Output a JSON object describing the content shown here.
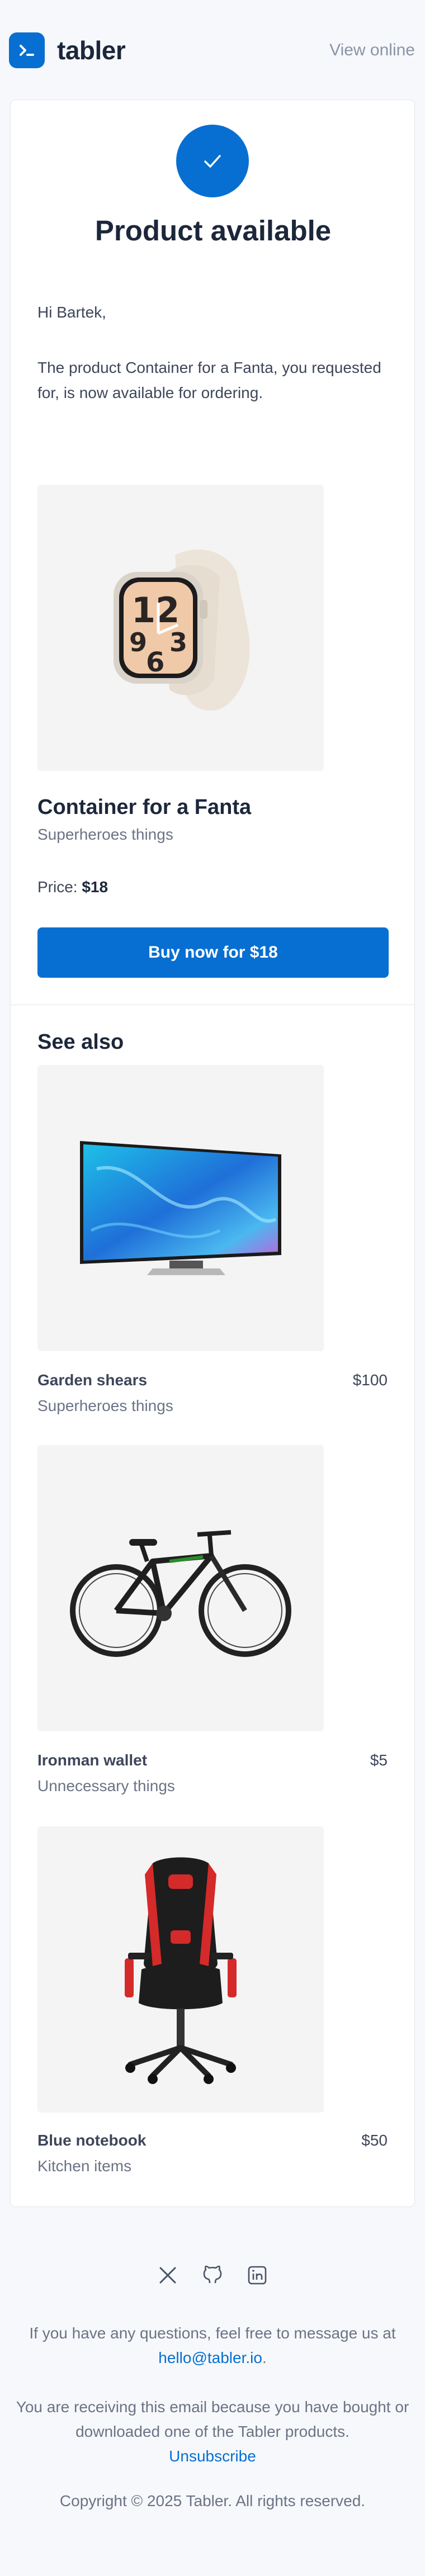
{
  "header": {
    "brand": "tabler",
    "view_online": "View online"
  },
  "email": {
    "title": "Product available",
    "greeting": "Hi Bartek,",
    "message": "The product Container for a Fanta, you requested for, is now available for ordering."
  },
  "product": {
    "name": "Container for a Fanta",
    "category": "Superheroes things",
    "price_label": "Price:",
    "price": "$18",
    "buy_button": "Buy now for $18",
    "image_icon": "smartwatch-image"
  },
  "see_also": {
    "title": "See also",
    "items": [
      {
        "name": "Garden shears",
        "category": "Superheroes things",
        "price": "$100",
        "image_icon": "television-image"
      },
      {
        "name": "Ironman wallet",
        "category": "Unnecessary things",
        "price": "$5",
        "image_icon": "bicycle-image"
      },
      {
        "name": "Blue notebook",
        "category": "Kitchen items",
        "price": "$50",
        "image_icon": "gaming-chair-image"
      }
    ]
  },
  "footer": {
    "social_icons": [
      "x-icon",
      "github-icon",
      "linkedin-icon"
    ],
    "questions_text": "If you have any questions, feel free to message us at",
    "email": "hello@tabler.io",
    "questions_end": ".",
    "receiving_text": "You are receiving this email because you have bought or downloaded one of the Tabler products.",
    "unsubscribe": "Unsubscribe",
    "copyright": "Copyright © 2025 Tabler. All rights reserved."
  },
  "colors": {
    "accent": "#066fd1",
    "background": "#f6f8fb",
    "card": "#ffffff",
    "text": "#1d273b",
    "muted": "#6b7385"
  }
}
